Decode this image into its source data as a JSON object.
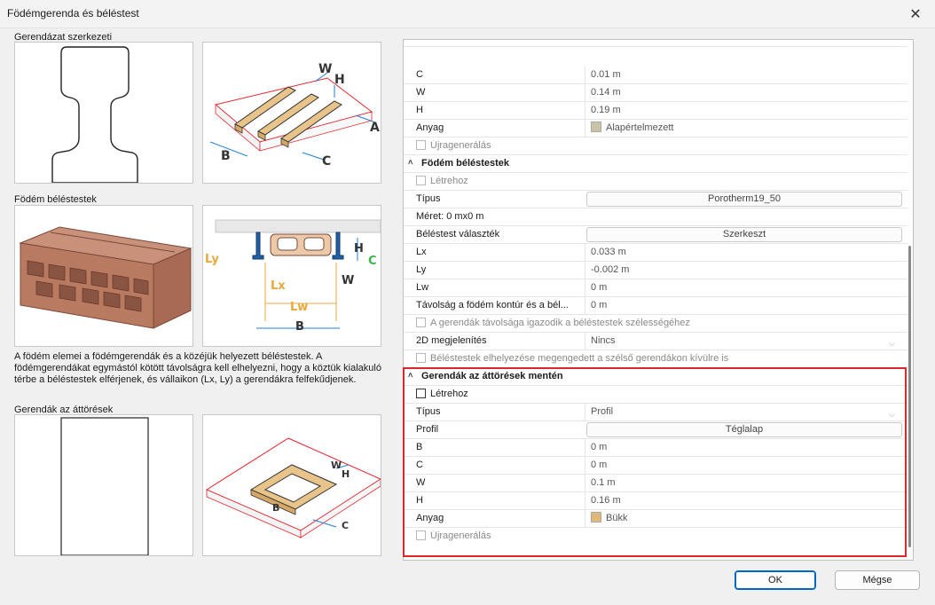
{
  "window": {
    "title": "Födémgerenda és béléstest",
    "close_glyph": "✕"
  },
  "left": {
    "beam_structure_label": "Gerendázat szerkezeti",
    "infill_label": "Födém béléstestek",
    "openings_label": "Gerendák az áttörések",
    "description": "A födém elemei a födémgerendák és a közéjük helyezett béléstestek. A födémgerendákat egymástól kötött távolságra kell elhelyezni, hogy a köztük kialakuló térbe a béléstestek elférjenek, és vállaikon (Lx, Ly) a gerendákra felfekűdjenek. ",
    "diagram_labels": {
      "w": "W",
      "h": "H",
      "a": "A",
      "b": "B",
      "c": "C",
      "ly": "Ly",
      "lx": "Lx",
      "lw": "Lw"
    }
  },
  "props": {
    "rows_top": [
      {
        "label": "C",
        "value": "0.01 m"
      },
      {
        "label": "W",
        "value": "0.14 m"
      },
      {
        "label": "H",
        "value": "0.19 m"
      },
      {
        "label": "Anyag",
        "value": "Alapértelmezett",
        "swatch": "#c9c4a6"
      }
    ],
    "regen1": "Újragenerálás",
    "infill_category": "Födém béléstestek",
    "create1": "Létrehoz",
    "type_label": "Típus",
    "type_value": "Porotherm19_50",
    "size_label": "Méret: 0 mx0 m",
    "infill_select_label": "Béléstest választék",
    "infill_select_btn": "Szerkeszt",
    "rows_infill": [
      {
        "label": "Lx",
        "value": "0.033 m"
      },
      {
        "label": "Ly",
        "value": "-0.002 m"
      },
      {
        "label": "Lw",
        "value": "0 m"
      },
      {
        "label": "Távolság a födém kontúr és a bél...",
        "value": "0 m"
      }
    ],
    "adjust_spacing": "A gerendák távolsága igazodik a béléstestek szélességéhez",
    "display2d_label": "2D megjelenítés",
    "display2d_value": "Nincs",
    "allow_outside": "Béléstestek elhelyezése megengedett a szélső gerendákon kívülre is",
    "openings_category": "Gerendák az áttörések mentén",
    "create2": "Létrehoz",
    "open_type_label": "Típus",
    "open_type_value": "Profil",
    "profile_label": "Profil",
    "profile_btn": "Téglalap",
    "rows_openings": [
      {
        "label": "B",
        "value": "0 m"
      },
      {
        "label": "C",
        "value": "0 m"
      },
      {
        "label": "W",
        "value": "0.1 m"
      },
      {
        "label": "H",
        "value": "0.16 m"
      },
      {
        "label": "Anyag",
        "value": "Bükk",
        "swatch": "#e2b77a"
      }
    ],
    "regen2": "Újragenerálás"
  },
  "footer": {
    "ok": "OK",
    "cancel": "Mégse"
  },
  "colors": {
    "highlight": "#e0262d",
    "primary": "#0067c0",
    "wood": "#e9c48a",
    "brick": "#c0826a"
  }
}
